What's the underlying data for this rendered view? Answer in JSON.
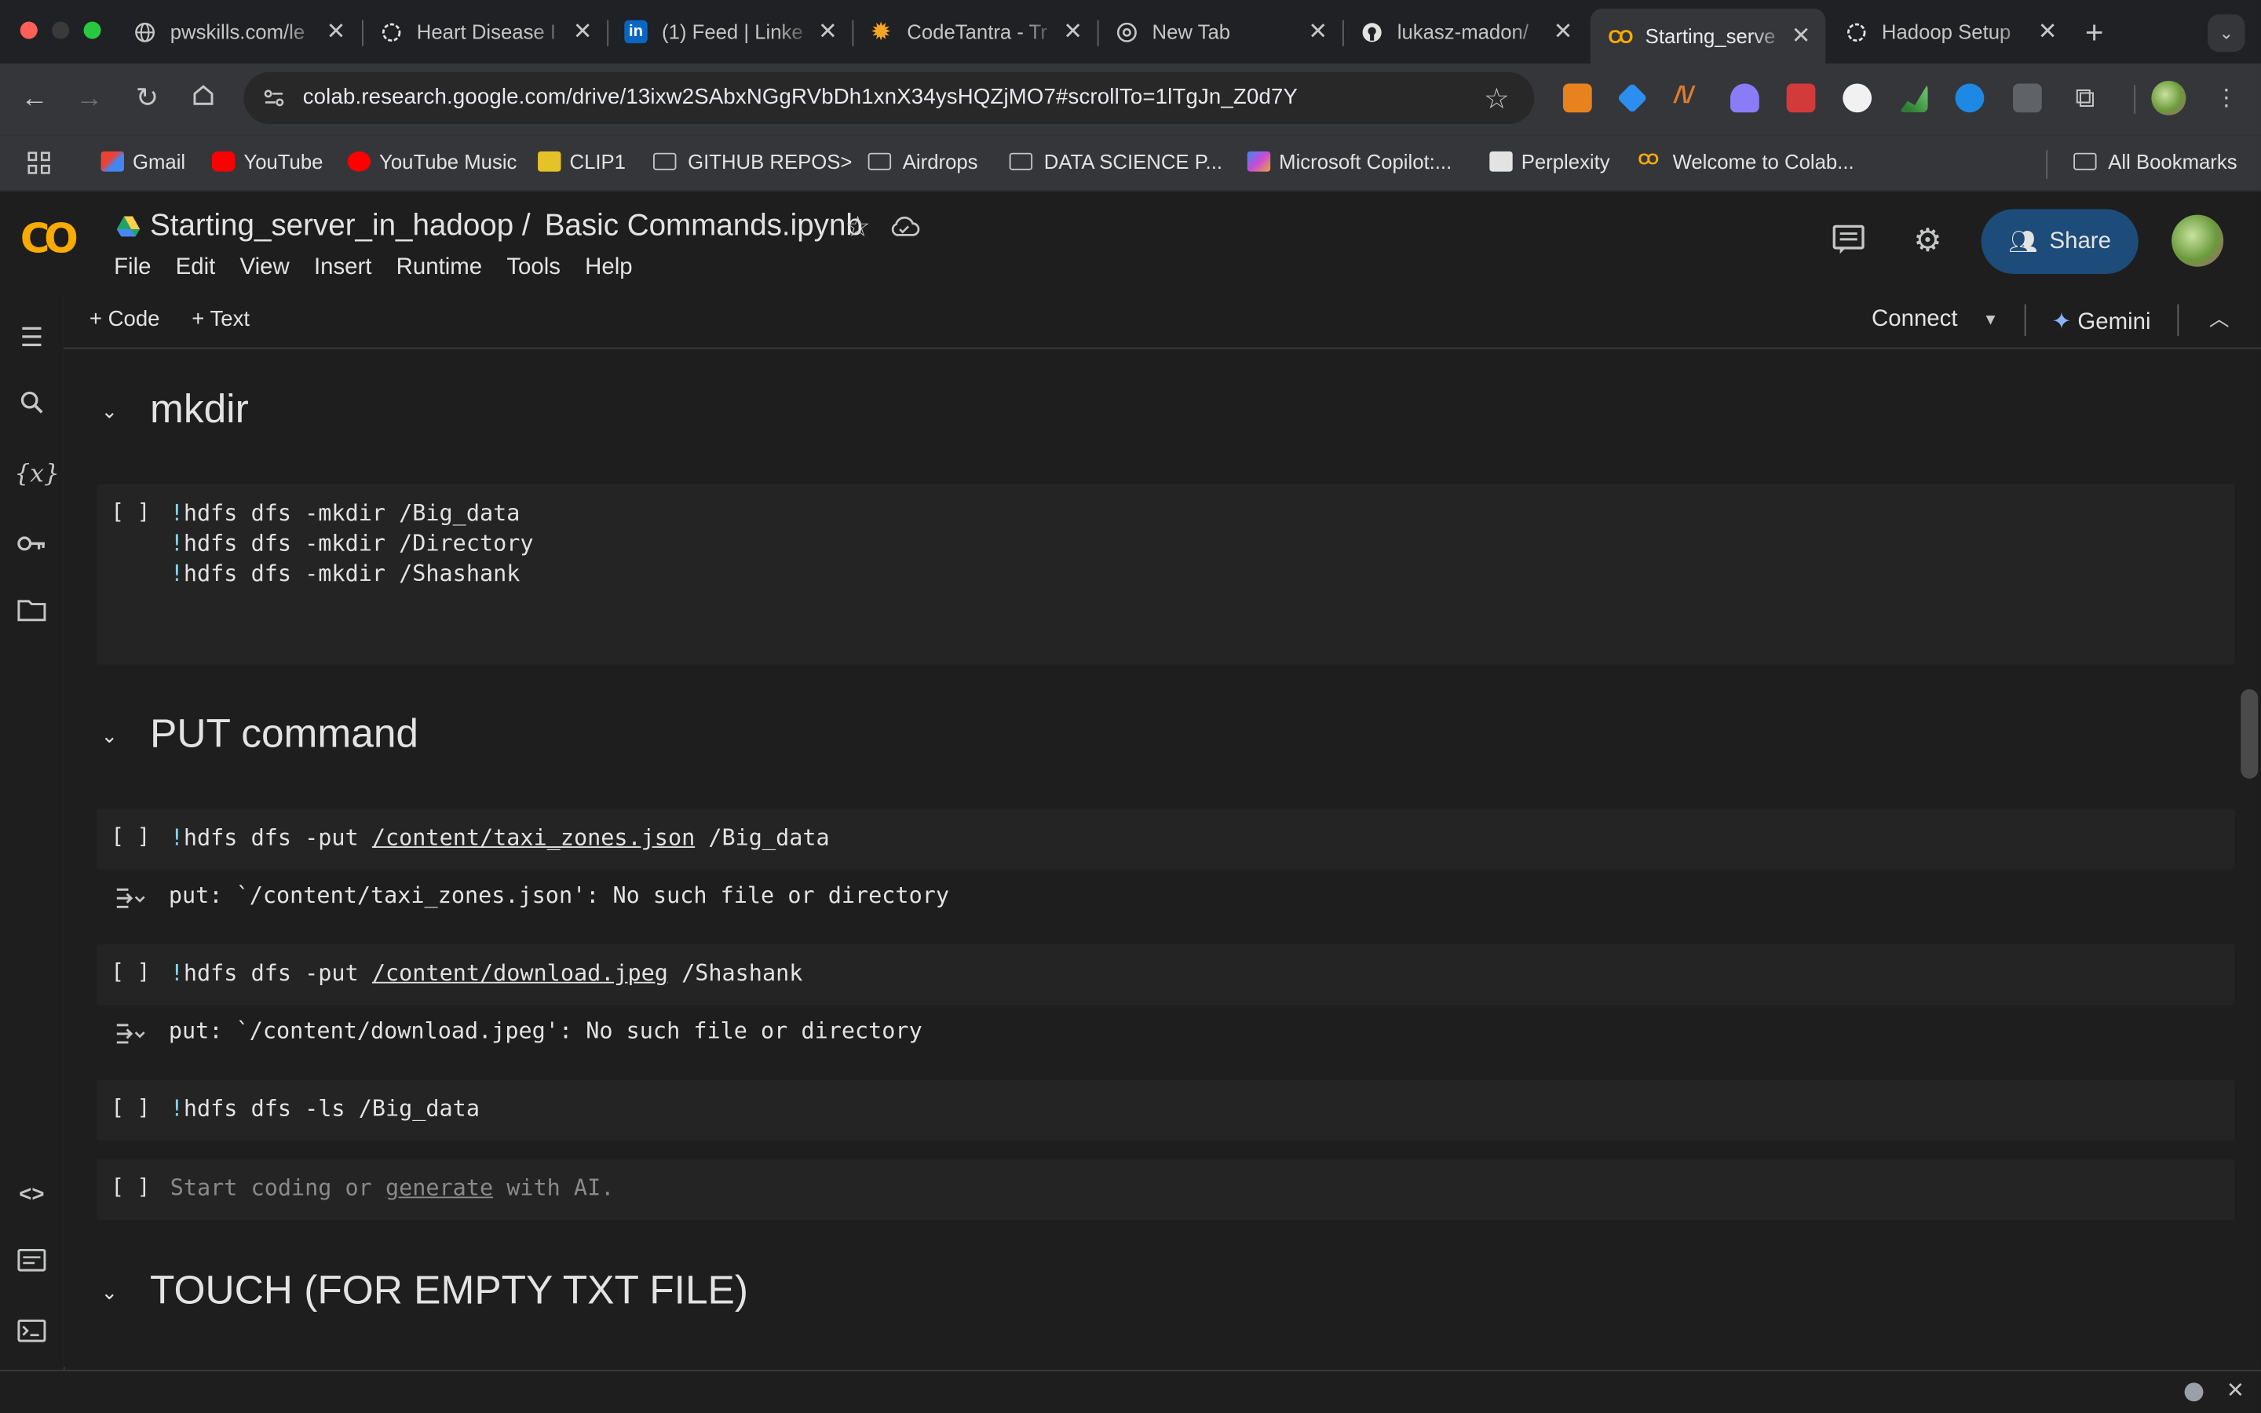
{
  "tabs": [
    {
      "title": "pwskills.com/le",
      "favicon": "globe-icon"
    },
    {
      "title": "Heart Disease I",
      "favicon": "openai-icon"
    },
    {
      "title": "(1) Feed | Linke",
      "favicon": "linkedin-icon"
    },
    {
      "title": "CodeTantra - Tr",
      "favicon": "codetantra-icon"
    },
    {
      "title": "New Tab",
      "favicon": "chrome-icon"
    },
    {
      "title": "lukasz-madon/",
      "favicon": "github-icon"
    },
    {
      "title": "Starting_serve",
      "favicon": "colab-icon",
      "active": true
    },
    {
      "title": "Hadoop Setup",
      "favicon": "openai-icon"
    }
  ],
  "url": "colab.research.google.com/drive/13ixw2SAbxNGgRVbDh1xnX34ysHQZjMO7#scrollTo=1lTgJn_Z0d7Y",
  "bookmarks": [
    {
      "label": "Gmail"
    },
    {
      "label": "YouTube"
    },
    {
      "label": "YouTube Music"
    },
    {
      "label": "CLIP1"
    },
    {
      "label": "GITHUB REPOS>"
    },
    {
      "label": "Airdrops"
    },
    {
      "label": "DATA SCIENCE P..."
    },
    {
      "label": "Microsoft Copilot:..."
    },
    {
      "label": "Perplexity"
    },
    {
      "label": "Welcome to Colab..."
    },
    {
      "label": "All Bookmarks"
    }
  ],
  "notebook": {
    "folder": "Starting_server_in_hadoop /",
    "name": "Basic Commands.ipynb"
  },
  "menu": [
    "File",
    "Edit",
    "View",
    "Insert",
    "Runtime",
    "Tools",
    "Help"
  ],
  "share_label": "Share",
  "toolbar": {
    "add_code": "+ Code",
    "add_text": "+ Text",
    "connect": "Connect",
    "gemini": "Gemini"
  },
  "cells": {
    "h_mkdir": "mkdir",
    "mkdir_lines": [
      "hdfs dfs -mkdir /Big_data",
      "hdfs dfs -mkdir /Directory",
      "hdfs dfs -mkdir /Shashank"
    ],
    "h_put": "PUT command",
    "put1_cmd": "hdfs dfs -put ",
    "put1_path": "/content/taxi_zones.json",
    "put1_dest": " /Big_data",
    "put1_out": "put: `/content/taxi_zones.json': No such file or directory",
    "put2_cmd": "hdfs dfs -put ",
    "put2_path": "/content/download.jpeg",
    "put2_dest": " /Shashank",
    "put2_out": "put: `/content/download.jpeg': No such file or directory",
    "ls_cmd": "hdfs dfs -ls /Big_data",
    "empty_a": "Start coding or ",
    "empty_link": "generate",
    "empty_b": " with AI.",
    "h_touch": "TOUCH (FOR EMPTY TXT FILE)"
  },
  "run_bracket": "[ ]",
  "bang": "!",
  "colors": {
    "accent": "#f9ab00",
    "share": "#1d4b7a",
    "bang": "#81d4fa"
  }
}
